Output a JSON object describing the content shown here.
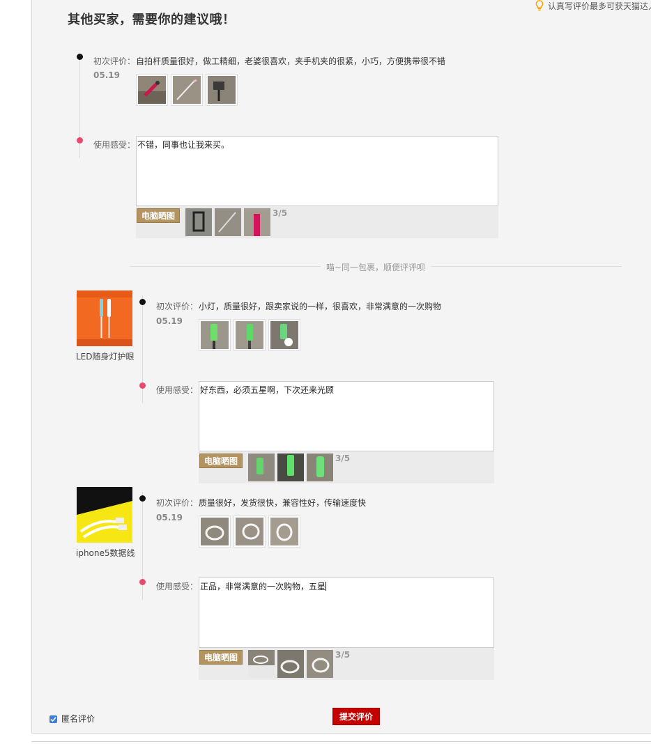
{
  "page": {
    "title": "其他买家，需要你的建议哦！",
    "tip": "认真写评价最多可获天猫达人"
  },
  "labels": {
    "first_review": "初次评价：",
    "feeling": "使用感受：",
    "upload_button": "电脑晒图"
  },
  "reviews": [
    {
      "first_review_text": "自拍杆质量很好，做工精细，老婆很喜欢，夹手机夹的很紧，小巧，方便携带很不错",
      "date": "05.19",
      "feeling_text": "不错，同事也让我来买。",
      "photo_count": "3/5"
    },
    {
      "product_name": "LED随身灯护眼",
      "first_review_text": "小灯，质量很好，跟卖家说的一样，很喜欢，非常满意的一次购物",
      "date": "05.19",
      "feeling_text": "好东西，必须五星啊，下次还来光顾",
      "photo_count": "3/5"
    },
    {
      "product_name": "iphone5数据线",
      "first_review_text": "质量很好，发货很快，兼容性好，传输速度快",
      "date": "05.19",
      "feeling_text": "正品，非常满意的一次购物，五星",
      "photo_count": "3/5"
    }
  ],
  "divider_text": "喵~同一包裹，顺便评评呗",
  "footer": {
    "anonymous_label": "匿名评价",
    "anonymous_checked": true,
    "submit_label": "提交评价"
  },
  "colors": {
    "accent": "#c40000",
    "upload_button": "#b39360",
    "feeling_dot": "#e84a6d",
    "checkbox": "#3d7fd7"
  }
}
